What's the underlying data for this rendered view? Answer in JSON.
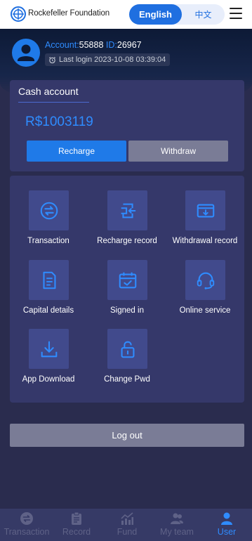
{
  "header": {
    "brand": "Rockefeller Foundation",
    "lang_en": "English",
    "lang_zh": "中文"
  },
  "profile": {
    "account_label": "Account:",
    "account_value": "55888",
    "id_label": "ID:",
    "id_value": "26967",
    "last_login": "Last login 2023-10-08 03:39:04"
  },
  "cash": {
    "title": "Cash account",
    "amount": "R$1003119",
    "recharge_label": "Recharge",
    "withdraw_label": "Withdraw"
  },
  "grid": {
    "items": [
      {
        "label": "Transaction",
        "icon": "exchange-icon"
      },
      {
        "label": "Recharge record",
        "icon": "recharge-record-icon"
      },
      {
        "label": "Withdrawal record",
        "icon": "withdrawal-record-icon"
      },
      {
        "label": "Capital details",
        "icon": "document-icon"
      },
      {
        "label": "Signed in",
        "icon": "calendar-check-icon"
      },
      {
        "label": "Online service",
        "icon": "headset-icon"
      },
      {
        "label": "App Download",
        "icon": "download-icon"
      },
      {
        "label": "Change Pwd",
        "icon": "lock-icon"
      }
    ]
  },
  "logout_label": "Log out",
  "nav": {
    "items": [
      {
        "label": "Transaction",
        "icon": "exchange-icon"
      },
      {
        "label": "Record",
        "icon": "clipboard-icon"
      },
      {
        "label": "Fund",
        "icon": "chart-icon"
      },
      {
        "label": "My team",
        "icon": "team-icon"
      },
      {
        "label": "User",
        "icon": "user-icon"
      }
    ],
    "active": "User"
  },
  "colors": {
    "accent": "#1f7ae8",
    "background": "#2a2c4e",
    "card": "#35386a",
    "tile": "#414a8c",
    "muted_button": "#7a7c96"
  }
}
